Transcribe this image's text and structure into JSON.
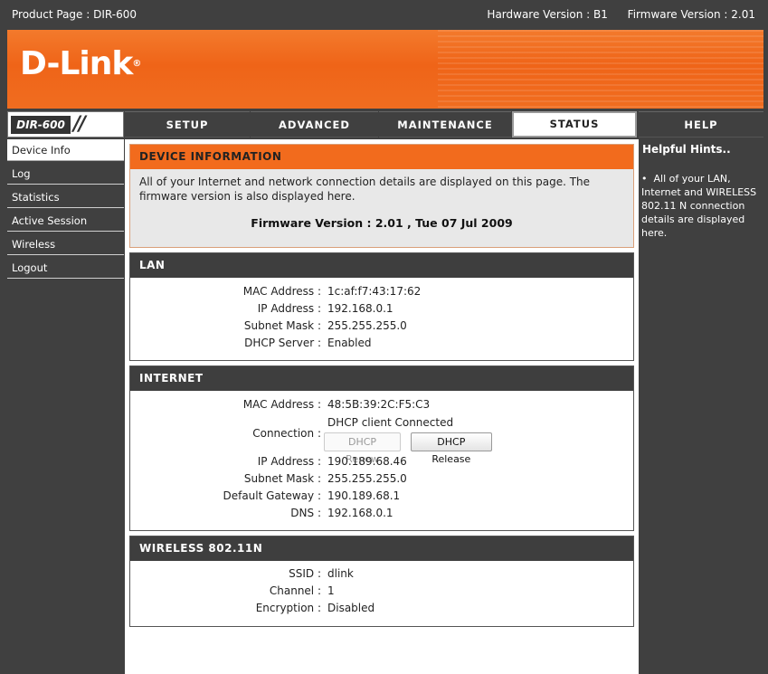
{
  "topbar": {
    "product_label": "Product Page :",
    "product_value": "DIR-600",
    "hardware": "Hardware Version : B1",
    "firmware": "Firmware Version : 2.01"
  },
  "banner": {
    "logo_text": "D-Link",
    "logo_mark": "®"
  },
  "nav": {
    "model": "DIR-600",
    "tabs": [
      "SETUP",
      "ADVANCED",
      "MAINTENANCE",
      "STATUS",
      "HELP"
    ],
    "active_tab": "STATUS"
  },
  "menu": {
    "items": [
      "Device Info",
      "Log",
      "Statistics",
      "Active Session",
      "Wireless",
      "Logout"
    ],
    "active": "Device Info"
  },
  "device_info": {
    "title": "DEVICE INFORMATION",
    "description": "All of your Internet and network connection details are displayed on this page. The firmware version is also displayed here.",
    "firmware": "Firmware Version : 2.01 ,  Tue 07 Jul 2009"
  },
  "lan": {
    "title": "LAN",
    "rows": [
      {
        "label": "MAC Address :",
        "value": "1c:af:f7:43:17:62"
      },
      {
        "label": "IP Address :",
        "value": "192.168.0.1"
      },
      {
        "label": "Subnet Mask :",
        "value": "255.255.255.0"
      },
      {
        "label": "DHCP Server :",
        "value": "Enabled"
      }
    ]
  },
  "internet": {
    "title": "INTERNET",
    "mac": {
      "label": "MAC Address :",
      "value": "48:5B:39:2C:F5:C3"
    },
    "connection": {
      "label": "Connection :",
      "status": "DHCP client  Connected",
      "renew_label": "DHCP Renew",
      "release_label": "DHCP Release"
    },
    "rows": [
      {
        "label": "IP Address :",
        "value": "190.189.68.46"
      },
      {
        "label": "Subnet Mask :",
        "value": "255.255.255.0"
      },
      {
        "label": "Default Gateway :",
        "value": "190.189.68.1"
      },
      {
        "label": "DNS :",
        "value": "192.168.0.1"
      }
    ]
  },
  "wireless": {
    "title": "WIRELESS 802.11N",
    "rows": [
      {
        "label": "SSID :",
        "value": "dlink"
      },
      {
        "label": "Channel :",
        "value": "1"
      },
      {
        "label": "Encryption :",
        "value": "Disabled"
      }
    ]
  },
  "help": {
    "title": "Helpful Hints..",
    "hint": "All of your LAN, Internet and WIRELESS 802.11 N connection details are displayed here."
  },
  "colors": {
    "orange": "#f26b1d",
    "dark": "#404040"
  }
}
